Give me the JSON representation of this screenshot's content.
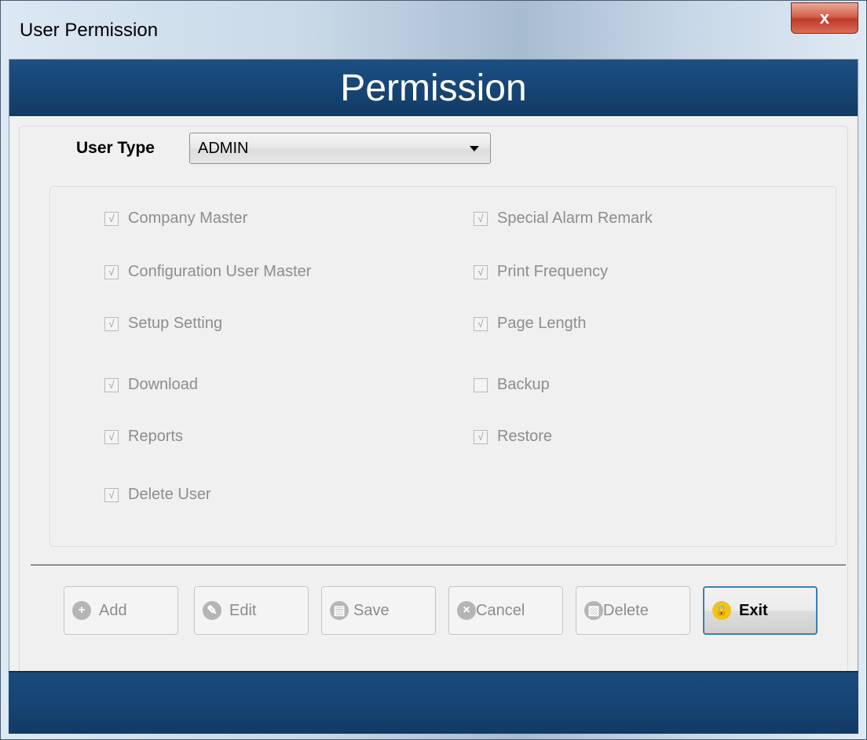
{
  "window": {
    "title": "User Permission",
    "close_glyph": "x"
  },
  "header": {
    "title": "Permission"
  },
  "user_type": {
    "label": "User Type",
    "selected": "ADMIN"
  },
  "permissions": {
    "company_master": {
      "label": "Company Master",
      "checked": true
    },
    "configuration_user_master": {
      "label": "Configuration User Master",
      "checked": true
    },
    "setup_setting": {
      "label": "Setup Setting",
      "checked": true
    },
    "download": {
      "label": "Download",
      "checked": true
    },
    "reports": {
      "label": "Reports",
      "checked": true
    },
    "delete_user": {
      "label": "Delete  User",
      "checked": true
    },
    "special_alarm_remark": {
      "label": "Special Alarm Remark",
      "checked": true
    },
    "print_frequency": {
      "label": "Print Frequency",
      "checked": true
    },
    "page_length": {
      "label": "Page Length",
      "checked": true
    },
    "backup": {
      "label": "Backup",
      "checked": false
    },
    "restore": {
      "label": "Restore",
      "checked": true
    }
  },
  "toolbar": {
    "add": {
      "label": "Add",
      "icon": "plus-circle-icon",
      "enabled": false
    },
    "edit": {
      "label": "Edit",
      "icon": "pencil-circle-icon",
      "enabled": false
    },
    "save": {
      "label": "Save",
      "icon": "floppy-disk-icon",
      "enabled": false
    },
    "cancel": {
      "label": "Cancel",
      "icon": "x-circle-icon",
      "enabled": false
    },
    "delete": {
      "label": "Delete",
      "icon": "trash-circle-icon",
      "enabled": false
    },
    "exit": {
      "label": "Exit",
      "icon": "lock-icon",
      "enabled": true
    }
  },
  "colors": {
    "header_band": "#164574",
    "close_button": "#c0392b",
    "exit_icon": "#f2c21a",
    "disabled_text": "#8d8d8d"
  }
}
